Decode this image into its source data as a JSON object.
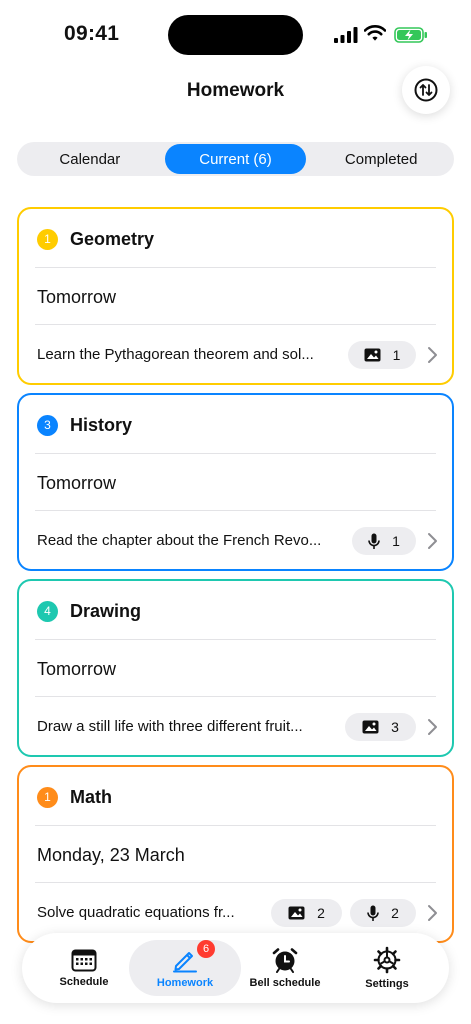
{
  "status_bar": {
    "time": "09:41",
    "battery_color": "#34c759"
  },
  "header": {
    "title": "Homework",
    "sort_icon": "sort-arrows-icon"
  },
  "tabs_segment": [
    "Calendar",
    "Current (6)",
    "Completed"
  ],
  "active_segment": 1,
  "accent": "#0a84ff",
  "cards": [
    {
      "number": "1",
      "subject": "Geometry",
      "date": "Tomorrow",
      "task": "Learn the Pythagorean theorem and sol...",
      "color": "#ffcc00",
      "attachments": [
        {
          "icon": "image-icon",
          "count": "1"
        }
      ]
    },
    {
      "number": "3",
      "subject": "History",
      "date": "Tomorrow",
      "task": "Read the chapter about the French Revo...",
      "color": "#0a84ff",
      "attachments": [
        {
          "icon": "microphone-icon",
          "count": "1"
        }
      ]
    },
    {
      "number": "4",
      "subject": "Drawing",
      "date": "Tomorrow",
      "task": "Draw a still life with three different fruit...",
      "color": "#1ec8b0",
      "attachments": [
        {
          "icon": "image-icon",
          "count": "3"
        }
      ]
    },
    {
      "number": "1",
      "subject": "Math",
      "date": "Monday, 23 March",
      "task": "Solve quadratic equations fr...",
      "color": "#ff8c1a",
      "attachments": [
        {
          "icon": "image-icon",
          "count": "2"
        },
        {
          "icon": "microphone-icon",
          "count": "2"
        }
      ]
    }
  ],
  "tabbar": {
    "items": [
      {
        "label": "Schedule",
        "icon": "calendar-grid-icon"
      },
      {
        "label": "Homework",
        "icon": "pencil-icon",
        "badge": "6"
      },
      {
        "label": "Bell schedule",
        "icon": "alarm-clock-icon"
      },
      {
        "label": "Settings",
        "icon": "gear-icon"
      }
    ]
  }
}
